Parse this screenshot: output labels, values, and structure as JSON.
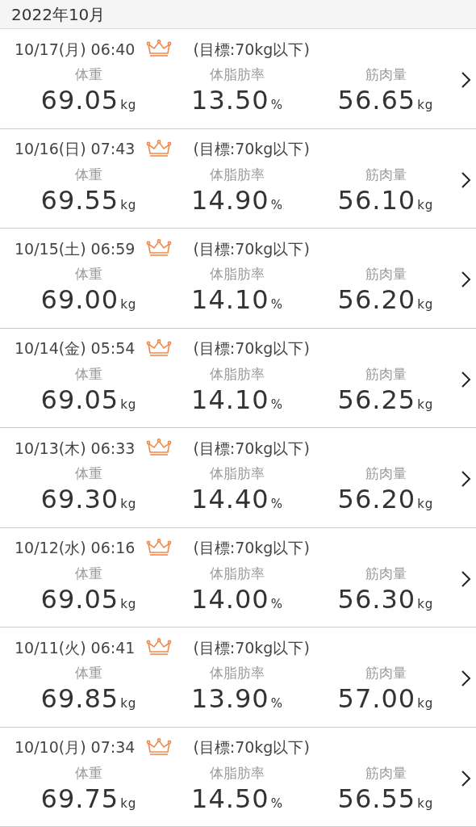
{
  "month": "2022年10月",
  "records": [
    {
      "datetime": "10/17(月) 06:40",
      "target": "(目標:70kg以下)",
      "metrics": [
        {
          "label": "体重",
          "value": "69.05",
          "unit": "kg"
        },
        {
          "label": "体脂肪率",
          "value": "13.50",
          "unit": "%"
        },
        {
          "label": "筋肉量",
          "value": "56.65",
          "unit": "kg"
        }
      ]
    },
    {
      "datetime": "10/16(日) 07:43",
      "target": "(目標:70kg以下)",
      "metrics": [
        {
          "label": "体重",
          "value": "69.55",
          "unit": "kg"
        },
        {
          "label": "体脂肪率",
          "value": "14.90",
          "unit": "%"
        },
        {
          "label": "筋肉量",
          "value": "56.10",
          "unit": "kg"
        }
      ]
    },
    {
      "datetime": "10/15(土) 06:59",
      "target": "(目標:70kg以下)",
      "metrics": [
        {
          "label": "体重",
          "value": "69.00",
          "unit": "kg"
        },
        {
          "label": "体脂肪率",
          "value": "14.10",
          "unit": "%"
        },
        {
          "label": "筋肉量",
          "value": "56.20",
          "unit": "kg"
        }
      ]
    },
    {
      "datetime": "10/14(金) 05:54",
      "target": "(目標:70kg以下)",
      "metrics": [
        {
          "label": "体重",
          "value": "69.05",
          "unit": "kg"
        },
        {
          "label": "体脂肪率",
          "value": "14.10",
          "unit": "%"
        },
        {
          "label": "筋肉量",
          "value": "56.25",
          "unit": "kg"
        }
      ]
    },
    {
      "datetime": "10/13(木) 06:33",
      "target": "(目標:70kg以下)",
      "metrics": [
        {
          "label": "体重",
          "value": "69.30",
          "unit": "kg"
        },
        {
          "label": "体脂肪率",
          "value": "14.40",
          "unit": "%"
        },
        {
          "label": "筋肉量",
          "value": "56.20",
          "unit": "kg"
        }
      ]
    },
    {
      "datetime": "10/12(水) 06:16",
      "target": "(目標:70kg以下)",
      "metrics": [
        {
          "label": "体重",
          "value": "69.05",
          "unit": "kg"
        },
        {
          "label": "体脂肪率",
          "value": "14.00",
          "unit": "%"
        },
        {
          "label": "筋肉量",
          "value": "56.30",
          "unit": "kg"
        }
      ]
    },
    {
      "datetime": "10/11(火) 06:41",
      "target": "(目標:70kg以下)",
      "metrics": [
        {
          "label": "体重",
          "value": "69.85",
          "unit": "kg"
        },
        {
          "label": "体脂肪率",
          "value": "13.90",
          "unit": "%"
        },
        {
          "label": "筋肉量",
          "value": "57.00",
          "unit": "kg"
        }
      ]
    },
    {
      "datetime": "10/10(月) 07:34",
      "target": "(目標:70kg以下)",
      "metrics": [
        {
          "label": "体重",
          "value": "69.75",
          "unit": "kg"
        },
        {
          "label": "体脂肪率",
          "value": "14.50",
          "unit": "%"
        },
        {
          "label": "筋肉量",
          "value": "56.55",
          "unit": "kg"
        }
      ]
    }
  ]
}
